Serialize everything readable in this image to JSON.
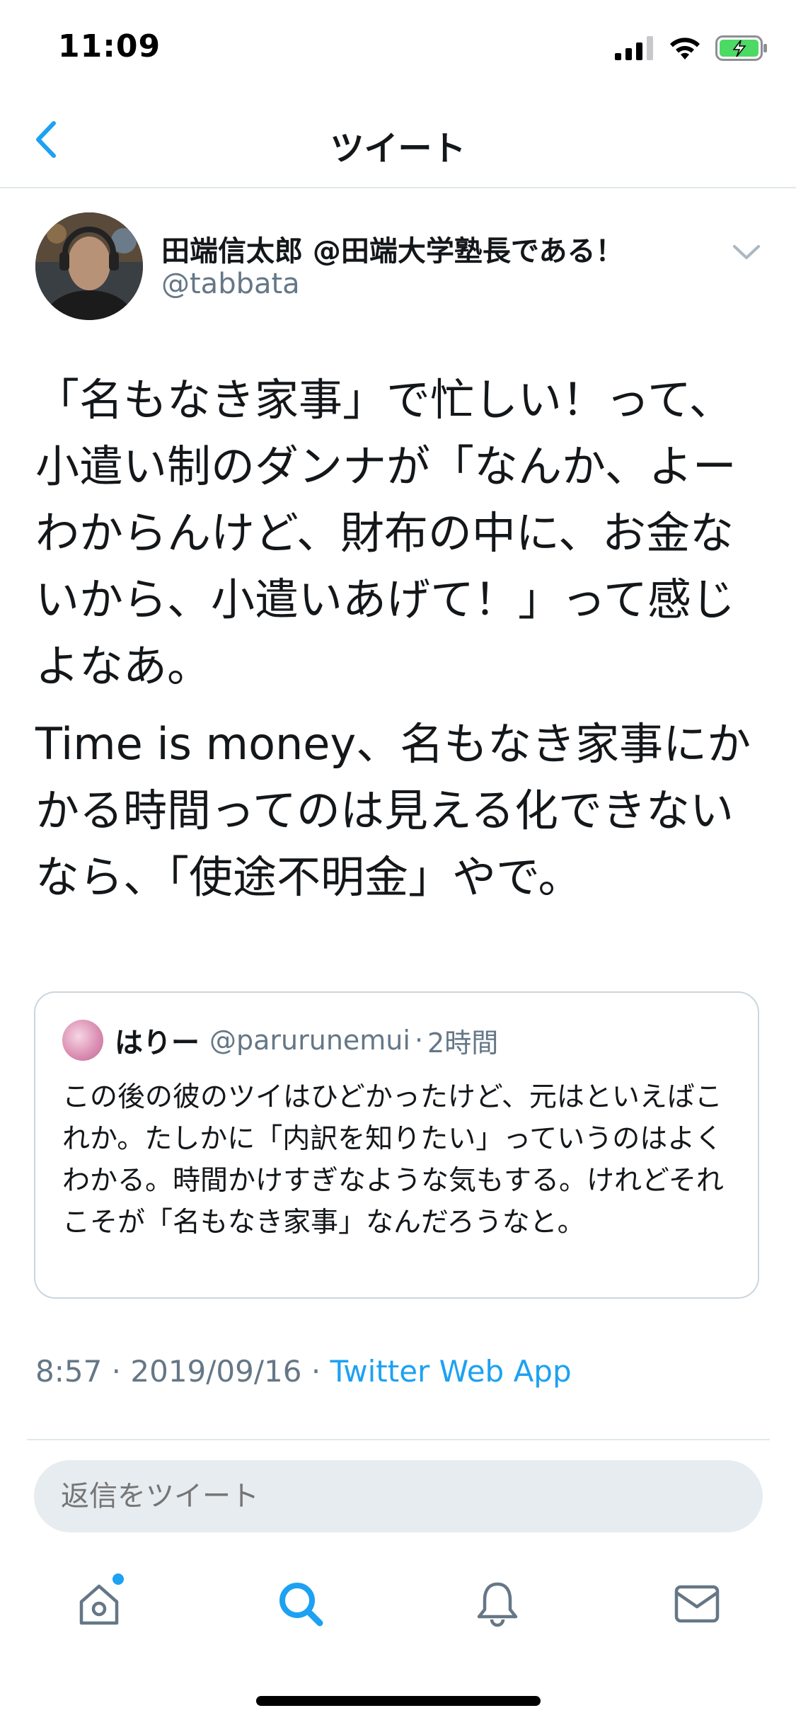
{
  "status_bar": {
    "time": "11:09",
    "battery_color": "#4cd964"
  },
  "nav": {
    "title": "ツイート",
    "back_icon": "chevron-left-icon"
  },
  "tweet": {
    "author": {
      "display_name": "田端信太郎 @田端大学塾長である！",
      "handle": "@tabbata"
    },
    "text": [
      "「名もなき家事」で忙しい！って、小遣い制のダンナが「なんか、よーわからんけど、財布の中に、お金ないから、小遣いあげて！」って感じよなあ。",
      "Time is money、名もなき家事にかかる時間ってのは見える化できないなら、「使途不明金」やで。"
    ],
    "quote": {
      "name": "はりー",
      "handle": "@parurunemui",
      "separator": "·",
      "time": "2時間",
      "text": "この後の彼のツイはひどかったけど、元はといえばこれか。たしかに「内訳を知りたい」っていうのはよくわかる。時間かけすぎなような気もする。けれどそれこそが「名もなき家事」なんだろうなと。"
    },
    "meta": {
      "time": "8:57",
      "sep1": " · ",
      "date": "2019/09/16",
      "sep2": " · ",
      "source": "Twitter Web App"
    }
  },
  "reply": {
    "placeholder": "返信をツイート"
  },
  "tabs": [
    {
      "name": "home",
      "icon": "home-icon",
      "active": false,
      "has_dot": true
    },
    {
      "name": "search",
      "icon": "search-icon",
      "active": true
    },
    {
      "name": "notifications",
      "icon": "bell-icon",
      "active": false
    },
    {
      "name": "messages",
      "icon": "mail-icon",
      "active": false
    }
  ],
  "colors": {
    "accent": "#1da1f2",
    "secondary_text": "#657786",
    "border": "#e1e8ed"
  }
}
